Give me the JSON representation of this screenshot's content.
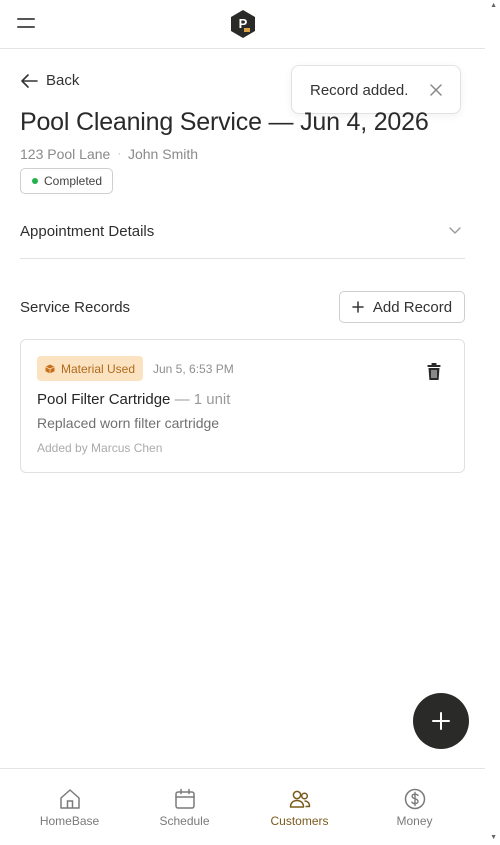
{
  "header": {
    "logo_letter": "P"
  },
  "back_label": "Back",
  "toast": {
    "message": "Record added."
  },
  "page_title": "Pool Cleaning Service — Jun 4, 2026",
  "address": "123 Pool Lane",
  "separator": "·",
  "customer_name": "John Smith",
  "status": {
    "label": "Completed",
    "color": "#22b14c"
  },
  "appointment_details_label": "Appointment Details",
  "service_records": {
    "title": "Service Records",
    "add_label": "Add Record",
    "items": [
      {
        "tag": "Material Used",
        "timestamp": "Jun 5, 6:53 PM",
        "item_name": "Pool Filter Cartridge",
        "quantity": "— 1 unit",
        "description": "Replaced worn filter cartridge",
        "added_by": "Added by Marcus Chen"
      }
    ]
  },
  "nav": {
    "items": [
      {
        "label": "HomeBase",
        "icon": "home-icon"
      },
      {
        "label": "Schedule",
        "icon": "calendar-icon"
      },
      {
        "label": "Customers",
        "icon": "users-icon",
        "active": true
      },
      {
        "label": "Money",
        "icon": "dollar-icon"
      }
    ]
  },
  "colors": {
    "accent": "#7a5a1c",
    "fab": "#2a2a28",
    "tag_bg": "#fbe3c1",
    "tag_text": "#b06a1c"
  }
}
